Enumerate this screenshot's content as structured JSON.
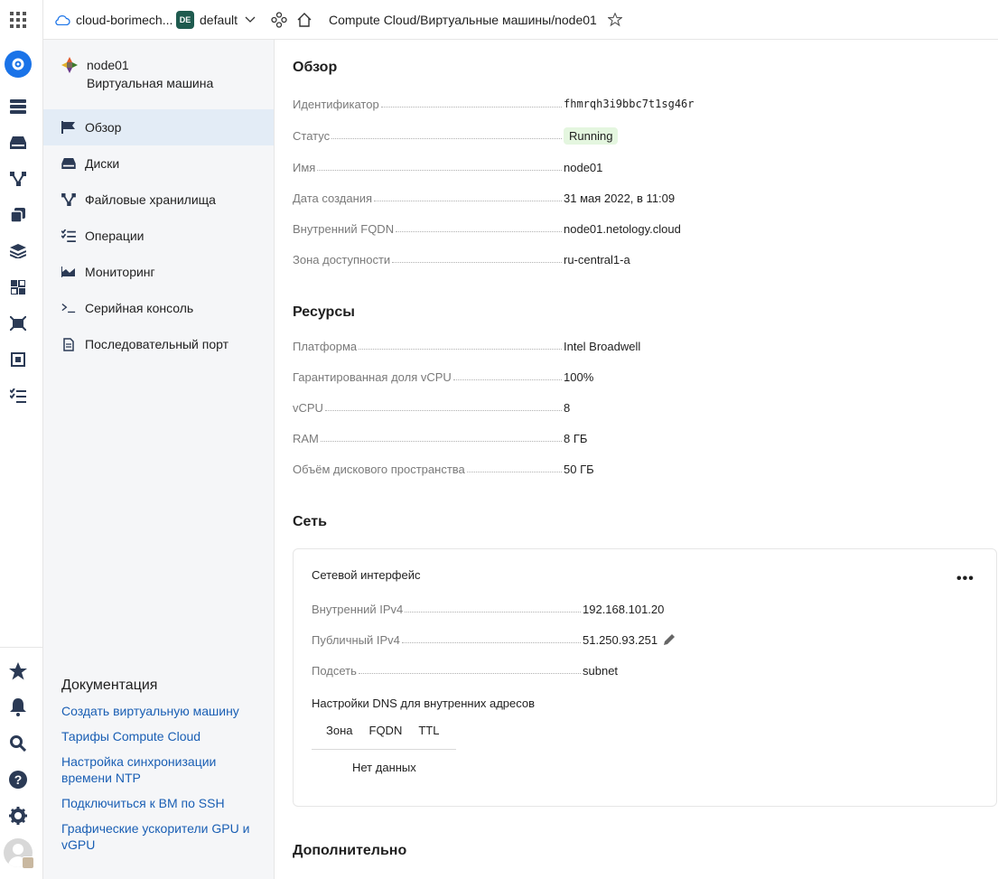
{
  "header": {
    "cloud_name": "cloud-borimech...",
    "folder_badge": "DE",
    "folder_name": "default",
    "breadcrumbs": [
      "Compute Cloud",
      "Виртуальные машины",
      "node01"
    ]
  },
  "resource": {
    "name": "node01",
    "type": "Виртуальная машина"
  },
  "nav": {
    "items": [
      {
        "label": "Обзор",
        "icon": "flag-icon",
        "active": true
      },
      {
        "label": "Диски",
        "icon": "disk-icon"
      },
      {
        "label": "Файловые хранилища",
        "icon": "file-storage-icon"
      },
      {
        "label": "Операции",
        "icon": "operations-list-icon"
      },
      {
        "label": "Мониторинг",
        "icon": "monitoring-chart-icon"
      },
      {
        "label": "Серийная консоль",
        "icon": "terminal-icon"
      },
      {
        "label": "Последовательный порт",
        "icon": "document-icon"
      }
    ]
  },
  "docs": {
    "title": "Документация",
    "links": [
      "Создать виртуальную машину",
      "Тарифы Compute Cloud",
      "Настройка синхронизации времени NTP",
      "Подключиться к ВМ по SSH",
      "Графические ускорители GPU и vGPU"
    ]
  },
  "overview": {
    "title": "Обзор",
    "rows": [
      {
        "label": "Идентификатор",
        "value": "fhmrqh3i9bbc7t1sg46r"
      },
      {
        "label": "Статус",
        "value": "Running"
      },
      {
        "label": "Имя",
        "value": "node01"
      },
      {
        "label": "Дата создания",
        "value": "31 мая 2022, в 11:09"
      },
      {
        "label": "Внутренний FQDN",
        "value": "node01.netology.cloud"
      },
      {
        "label": "Зона доступности",
        "value": "ru-central1-a"
      }
    ]
  },
  "resources": {
    "title": "Ресурсы",
    "rows": [
      {
        "label": "Платформа",
        "value": "Intel Broadwell"
      },
      {
        "label": "Гарантированная доля vCPU",
        "value": "100%"
      },
      {
        "label": "vCPU",
        "value": "8"
      },
      {
        "label": "RAM",
        "value": "8 ГБ"
      },
      {
        "label": "Объём дискового пространства",
        "value": "50 ГБ"
      }
    ]
  },
  "network": {
    "title": "Сеть",
    "card_title": "Сетевой интерфейс",
    "menu": "•••",
    "rows": [
      {
        "label": "Внутренний IPv4",
        "value": "192.168.101.20"
      },
      {
        "label": "Публичный IPv4",
        "value": "51.250.93.251"
      },
      {
        "label": "Подсеть",
        "value": "subnet"
      }
    ],
    "dns_title": "Настройки DNS для внутренних адресов",
    "dns_columns": [
      "Зона",
      "FQDN",
      "TTL"
    ],
    "dns_empty": "Нет данных"
  },
  "additional": {
    "title": "Дополнительно"
  },
  "colors": {
    "accent": "#1a73e8",
    "link": "#1a5fb4",
    "status_bg": "#e4f6df",
    "status_text": "#2a8a1e"
  }
}
